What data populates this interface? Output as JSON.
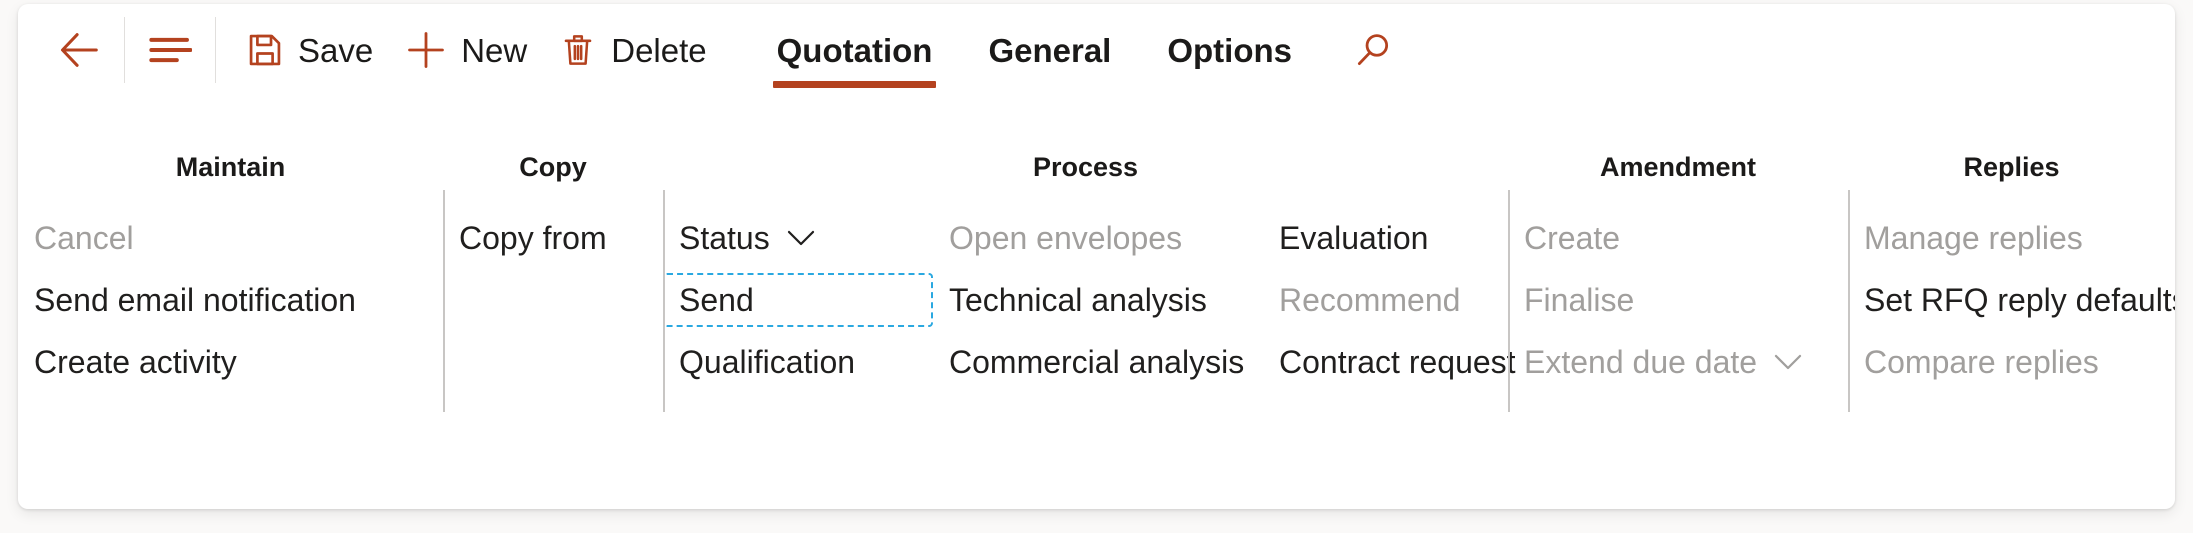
{
  "toolbar": {
    "back_icon": "back-arrow-icon",
    "list_icon": "show-list-icon",
    "save": {
      "label": "Save",
      "icon": "save-floppy-icon"
    },
    "new": {
      "label": "New",
      "icon": "plus-icon"
    },
    "delete": {
      "label": "Delete",
      "icon": "trash-icon"
    },
    "search_icon": "search-magnifier-icon",
    "tabs": [
      {
        "label": "Quotation",
        "active": true
      },
      {
        "label": "General",
        "active": false
      },
      {
        "label": "Options",
        "active": false
      }
    ]
  },
  "colors": {
    "accent": "#b4421f",
    "focus_outline": "#2aa8e0",
    "disabled_text": "#a19f9d",
    "text": "#201f1e",
    "divider": "#c8c6c4"
  },
  "groups": [
    {
      "title": "Maintain",
      "columns": [
        {
          "items": [
            {
              "label": "Cancel",
              "disabled": true,
              "chevron": false,
              "focused": false
            },
            {
              "label": "Send email notification",
              "disabled": false,
              "chevron": false,
              "focused": false
            },
            {
              "label": "Create activity",
              "disabled": false,
              "chevron": false,
              "focused": false
            }
          ]
        }
      ]
    },
    {
      "title": "Copy",
      "columns": [
        {
          "items": [
            {
              "label": "Copy from",
              "disabled": false,
              "chevron": false,
              "focused": false
            }
          ]
        }
      ]
    },
    {
      "title": "Process",
      "columns": [
        {
          "items": [
            {
              "label": "Status",
              "disabled": false,
              "chevron": true,
              "focused": false
            },
            {
              "label": "Send",
              "disabled": false,
              "chevron": false,
              "focused": true
            },
            {
              "label": "Qualification",
              "disabled": false,
              "chevron": false,
              "focused": false
            }
          ]
        },
        {
          "items": [
            {
              "label": "Open envelopes",
              "disabled": true,
              "chevron": false,
              "focused": false
            },
            {
              "label": "Technical analysis",
              "disabled": false,
              "chevron": false,
              "focused": false
            },
            {
              "label": "Commercial analysis",
              "disabled": false,
              "chevron": false,
              "focused": false
            }
          ]
        },
        {
          "items": [
            {
              "label": "Evaluation",
              "disabled": false,
              "chevron": false,
              "focused": false
            },
            {
              "label": "Recommend",
              "disabled": true,
              "chevron": false,
              "focused": false
            },
            {
              "label": "Contract request",
              "disabled": false,
              "chevron": false,
              "focused": false
            }
          ]
        }
      ]
    },
    {
      "title": "Amendment",
      "columns": [
        {
          "items": [
            {
              "label": "Create",
              "disabled": true,
              "chevron": false,
              "focused": false
            },
            {
              "label": "Finalise",
              "disabled": true,
              "chevron": false,
              "focused": false
            },
            {
              "label": "Extend due date",
              "disabled": true,
              "chevron": true,
              "focused": false
            }
          ]
        }
      ]
    },
    {
      "title": "Replies",
      "columns": [
        {
          "items": [
            {
              "label": "Manage replies",
              "disabled": true,
              "chevron": false,
              "focused": false
            },
            {
              "label": "Set RFQ reply defaults",
              "disabled": false,
              "chevron": false,
              "focused": false
            },
            {
              "label": "Compare replies",
              "disabled": true,
              "chevron": false,
              "focused": false
            }
          ]
        }
      ]
    }
  ]
}
